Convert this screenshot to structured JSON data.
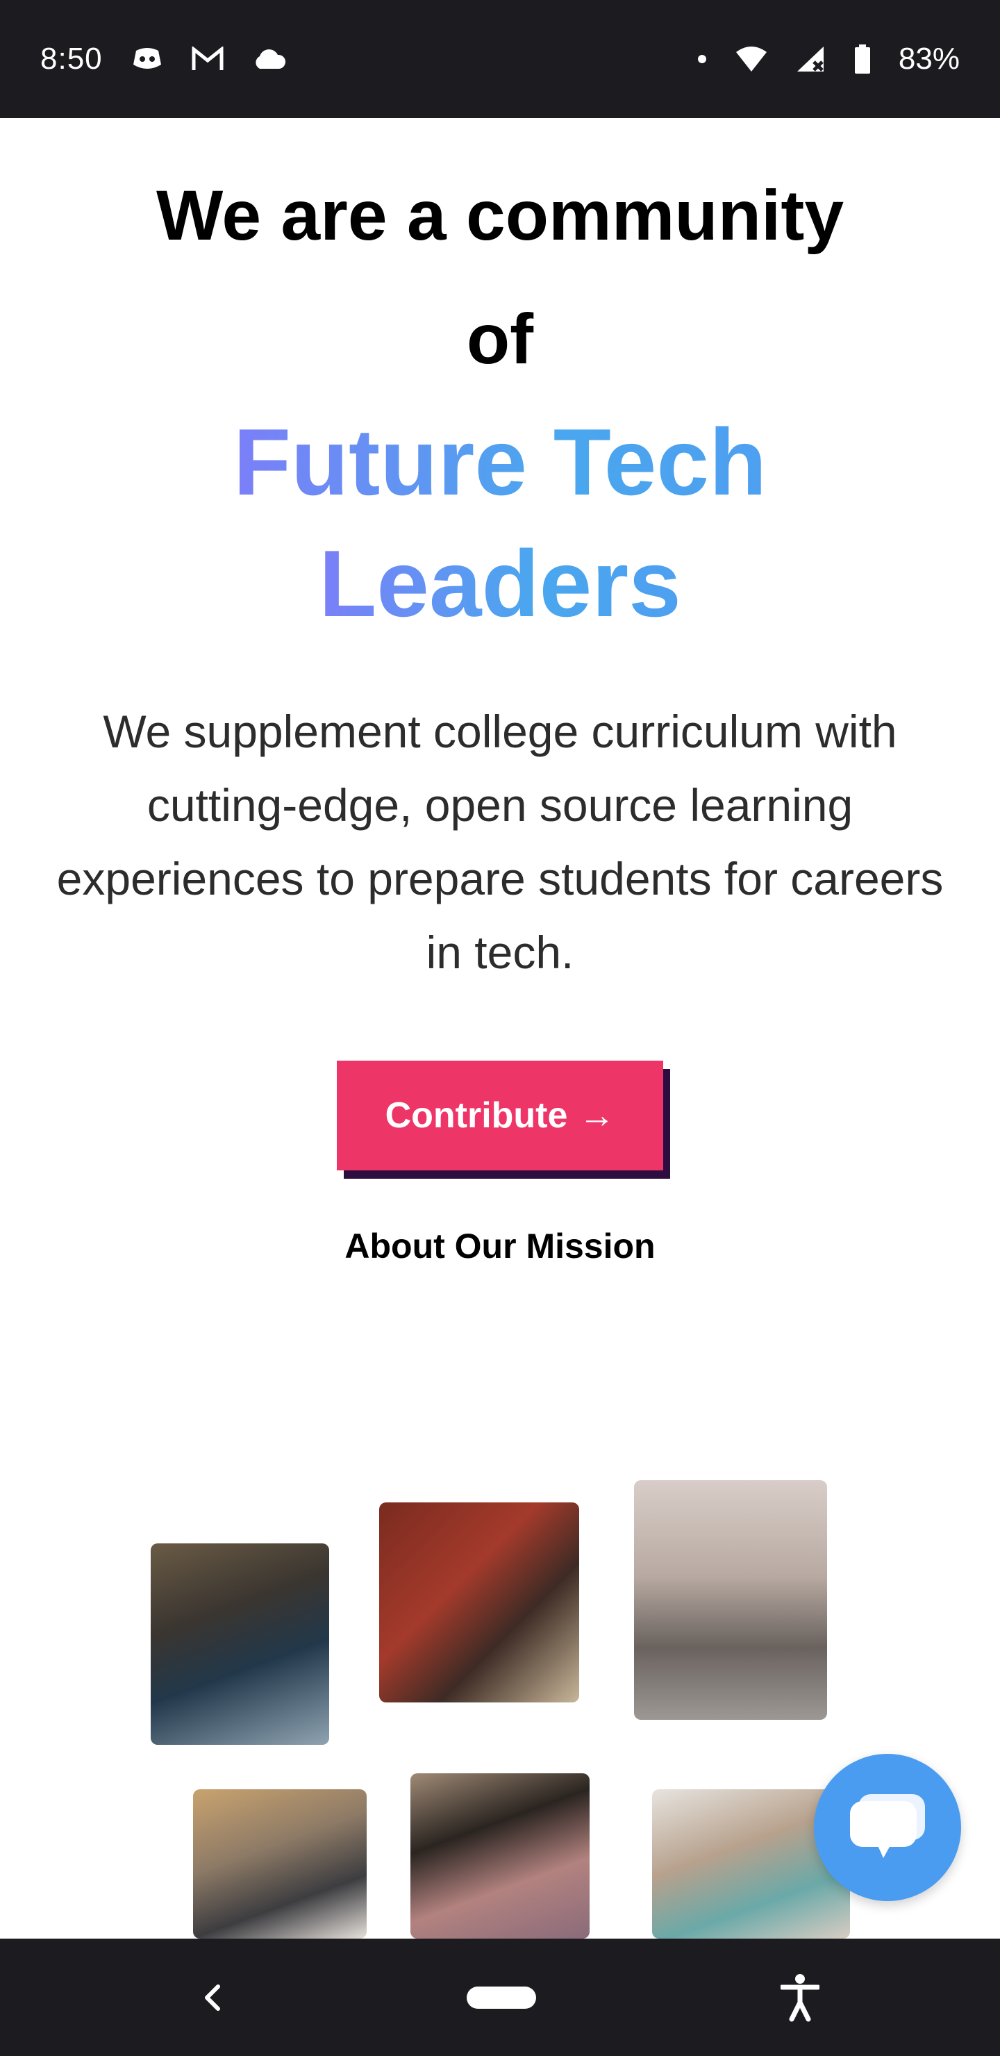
{
  "status_bar": {
    "time": "8:50",
    "left_icons": [
      "discord-icon",
      "gmail-icon",
      "cloud-icon"
    ],
    "right_icons": [
      "dot-icon",
      "wifi-icon",
      "signal-icon",
      "battery-icon"
    ],
    "battery": "83%"
  },
  "hero": {
    "line1": "We are a community",
    "line2": "of",
    "highlight_line1": "Future Tech",
    "highlight_line2": "Leaders",
    "description": "We supplement college curriculum with cutting-edge, open source learning experiences to prepare students for careers in tech."
  },
  "cta": {
    "contribute_label": "Contribute",
    "contribute_arrow": "→",
    "mission_label": "About Our Mission"
  },
  "photos": [
    "student-photo",
    "student-photo",
    "student-photo",
    "student-photo",
    "student-photo",
    "student-photo"
  ],
  "chat": {
    "icon": "chat-bubble-icon"
  },
  "nav_bar": {
    "icons": [
      "back-icon",
      "home-pill-icon",
      "accessibility-icon"
    ]
  },
  "colors": {
    "accent_pink": "#ee3568",
    "gradient_start": "#7b7ff8",
    "gradient_end": "#4e9ff0",
    "chat_blue": "#4a9cf0",
    "system_bar": "#1c1b20"
  }
}
